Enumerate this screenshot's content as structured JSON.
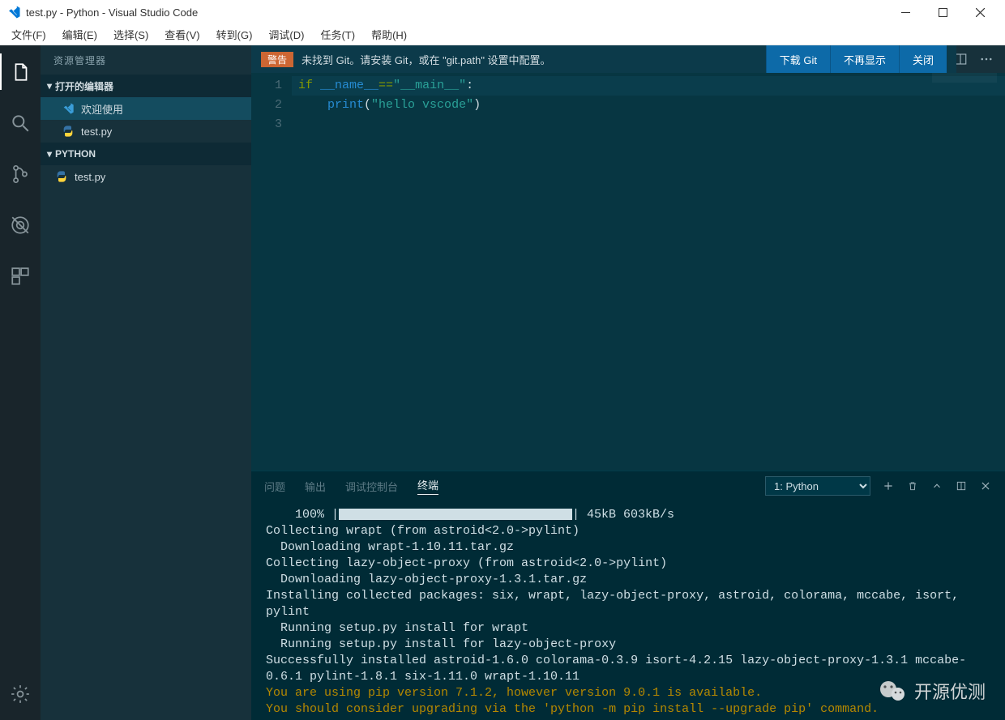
{
  "window": {
    "title": "test.py - Python - Visual Studio Code"
  },
  "menu": {
    "items": [
      "文件(F)",
      "编辑(E)",
      "选择(S)",
      "查看(V)",
      "转到(G)",
      "调试(D)",
      "任务(T)",
      "帮助(H)"
    ]
  },
  "sidebar": {
    "title": "资源管理器",
    "open_editors_label": "打开的编辑器",
    "open_editors": [
      {
        "label": "欢迎使用",
        "icon": "vscode"
      },
      {
        "label": "test.py",
        "icon": "python"
      }
    ],
    "folder_label": "PYTHON",
    "folder_items": [
      {
        "label": "test.py",
        "icon": "python"
      }
    ]
  },
  "notification": {
    "badge": "警告",
    "message": "未找到 Git。请安装 Git，或在 \"git.path\" 设置中配置。",
    "buttons": [
      "下载 Git",
      "不再显示",
      "关闭"
    ]
  },
  "editor": {
    "lines": [
      {
        "n": "1",
        "tokens": [
          [
            "kw",
            "if"
          ],
          [
            "pn",
            " "
          ],
          [
            "nm",
            "__name__"
          ],
          [
            "op",
            "=="
          ],
          [
            "str",
            "\"__main__\""
          ],
          [
            "pn",
            ":"
          ]
        ]
      },
      {
        "n": "2",
        "tokens": [
          [
            "pn",
            "    "
          ],
          [
            "fn",
            "print"
          ],
          [
            "pn",
            "("
          ],
          [
            "str",
            "\"hello vscode\""
          ],
          [
            "pn",
            ")"
          ]
        ]
      },
      {
        "n": "3",
        "tokens": []
      }
    ]
  },
  "panel": {
    "tabs": [
      "问题",
      "输出",
      "调试控制台",
      "终端"
    ],
    "active_tab": 3,
    "terminal_selector": "1: Python",
    "terminal": {
      "progress_pct": "100%",
      "progress_rate": "45kB 603kB/s",
      "lines_before": [
        "Collecting wrapt (from astroid<2.0->pylint)",
        "  Downloading wrapt-1.10.11.tar.gz",
        "Collecting lazy-object-proxy (from astroid<2.0->pylint)",
        "  Downloading lazy-object-proxy-1.3.1.tar.gz",
        "Installing collected packages: six, wrapt, lazy-object-proxy, astroid, colorama, mccabe, isort, pylint",
        "  Running setup.py install for wrapt",
        "  Running setup.py install for lazy-object-proxy",
        "Successfully installed astroid-1.6.0 colorama-0.3.9 isort-4.2.15 lazy-object-proxy-1.3.1 mccabe-0.6.1 pylint-1.8.1 six-1.11.0 wrapt-1.10.11"
      ],
      "warn_lines": [
        "You are using pip version 7.1.2, however version 9.0.1 is available.",
        "You should consider upgrading via the 'python -m pip install --upgrade pip' command."
      ]
    }
  },
  "watermark": {
    "text": "开源优测"
  }
}
